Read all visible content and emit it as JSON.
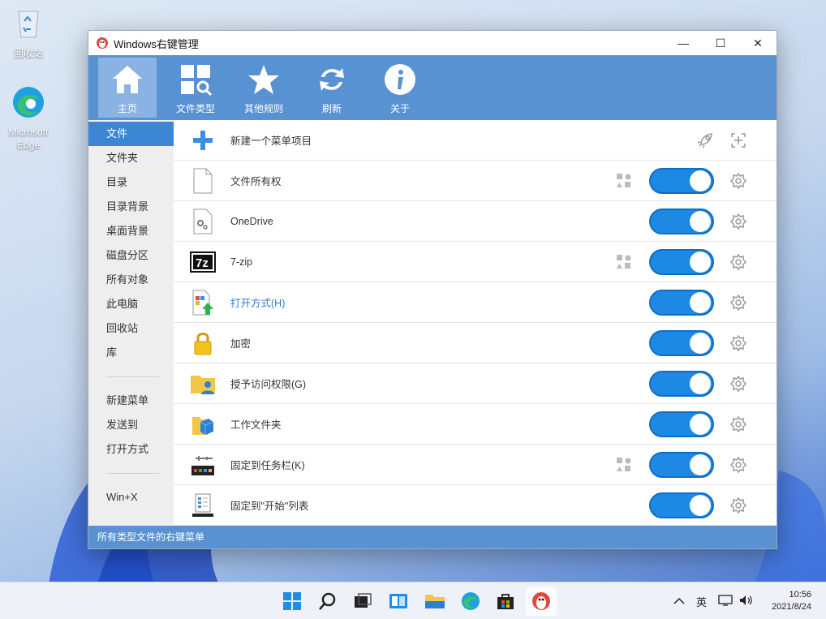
{
  "desktop": {
    "icons": [
      {
        "label": "回收站"
      },
      {
        "label": "Microsoft Edge"
      }
    ]
  },
  "window": {
    "title": "Windows右键管理",
    "controls": {
      "minimize": "—",
      "maximize": "☐",
      "close": "✕"
    }
  },
  "toolbar": {
    "items": [
      {
        "label": "主页",
        "icon": "home-icon",
        "active": true
      },
      {
        "label": "文件类型",
        "icon": "file-types-icon",
        "active": false
      },
      {
        "label": "其他规则",
        "icon": "star-icon",
        "active": false
      },
      {
        "label": "刷新",
        "icon": "refresh-icon",
        "active": false
      },
      {
        "label": "关于",
        "icon": "info-icon",
        "active": false
      }
    ]
  },
  "sidebar": {
    "group1": [
      "文件",
      "文件夹",
      "目录",
      "目录背景",
      "桌面背景",
      "磁盘分区",
      "所有对象",
      "此电脑",
      "回收站",
      "库"
    ],
    "group2": [
      "新建菜单",
      "发送到",
      "打开方式"
    ],
    "group3": [
      "Win+X"
    ],
    "active": "文件"
  },
  "list": {
    "new_item": {
      "label": "新建一个菜单项目"
    },
    "rows": [
      {
        "label": "文件所有权",
        "icon": "blank-file-icon",
        "group": true,
        "enabled": true
      },
      {
        "label": "OneDrive",
        "icon": "gear-file-icon",
        "group": false,
        "enabled": true
      },
      {
        "label": "7-zip",
        "icon": "7zip-icon",
        "group": true,
        "enabled": true
      },
      {
        "label": "打开方式(H)",
        "icon": "open-with-icon",
        "group": false,
        "enabled": true,
        "link": true
      },
      {
        "label": "加密",
        "icon": "lock-icon",
        "group": false,
        "enabled": true
      },
      {
        "label": "授予访问权限(G)",
        "icon": "share-folder-icon",
        "group": false,
        "enabled": true
      },
      {
        "label": "工作文件夹",
        "icon": "work-folder-icon",
        "group": false,
        "enabled": true
      },
      {
        "label": "固定到任务栏(K)",
        "icon": "pin-taskbar-icon",
        "group": true,
        "enabled": true
      },
      {
        "label": "固定到\"开始\"列表",
        "icon": "pin-start-icon",
        "group": false,
        "enabled": true
      }
    ]
  },
  "status": {
    "text": "所有类型文件的右键菜单"
  },
  "taskbar": {
    "ime": "英",
    "time": "10:56",
    "date": "2021/8/24"
  },
  "colors": {
    "accent": "#5892d3",
    "toggle_on": "#1e88e5",
    "sidebar_active": "#3d86d6"
  }
}
